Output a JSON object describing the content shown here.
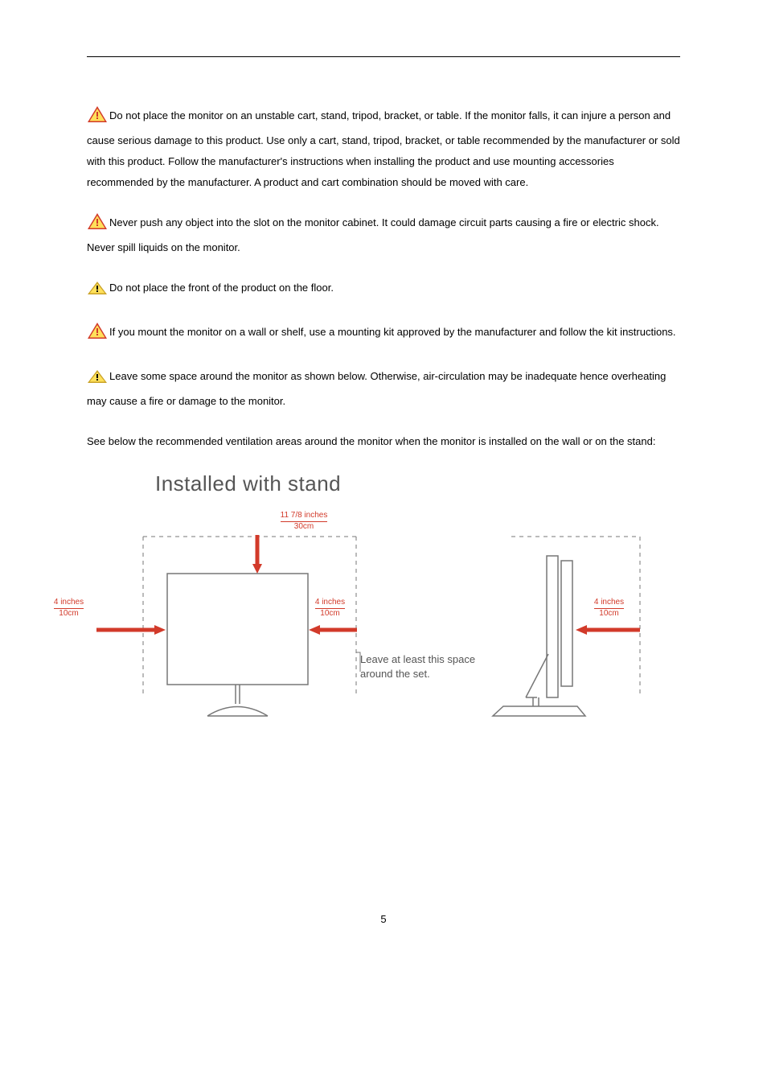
{
  "paragraphs": {
    "p1": "Do not place the monitor on an unstable cart, stand, tripod, bracket, or table. If the monitor falls, it can injure a person and cause serious damage to this product. Use only a cart, stand, tripod, bracket, or table recommended by the manufacturer or sold with this product. Follow the manufacturer's instructions when installing the product and use mounting accessories recommended by the manufacturer. A product and cart combination should be moved with care.",
    "p2": "Never push any object into the slot on the monitor cabinet. It could damage circuit parts causing a fire or electric shock. Never spill liquids on the monitor.",
    "p3": "Do not place the front of the product on the floor.",
    "p4": "If you mount the monitor on a wall or shelf, use a mounting kit approved by the manufacturer and follow the kit instructions.",
    "p5": "Leave some space around the monitor as shown below. Otherwise, air-circulation may be inadequate hence overheating may cause a fire or damage to the monitor.",
    "p6": "See below the recommended ventilation areas around the monitor when the monitor is installed on the wall or on the stand:"
  },
  "diagram": {
    "heading": "Installed with stand",
    "top_inches": "11 7/8 inches",
    "top_cm": "30cm",
    "side_inches": "4 inches",
    "side_cm": "10cm",
    "note_line1": "Leave at least this space",
    "note_line2": "around the set."
  },
  "page_number": "5"
}
